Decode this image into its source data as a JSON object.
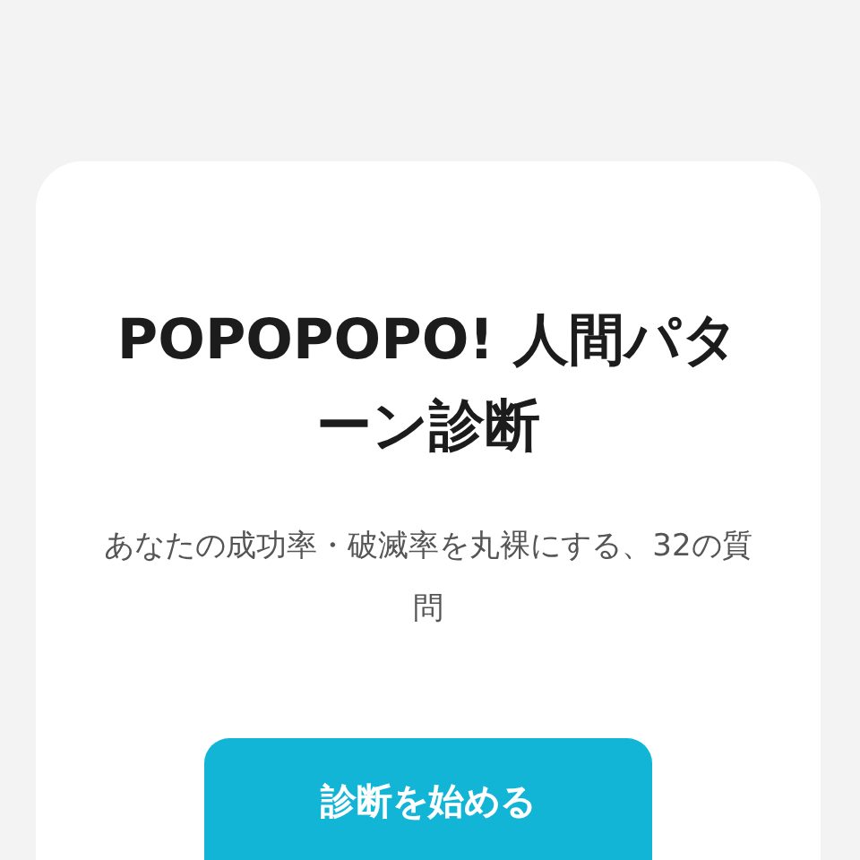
{
  "card": {
    "title": "POPOPOPO! 人間パターン診断",
    "subtitle": "あなたの成功率・破滅率を丸裸にする、32の質問",
    "start_button": "診断を始める"
  }
}
